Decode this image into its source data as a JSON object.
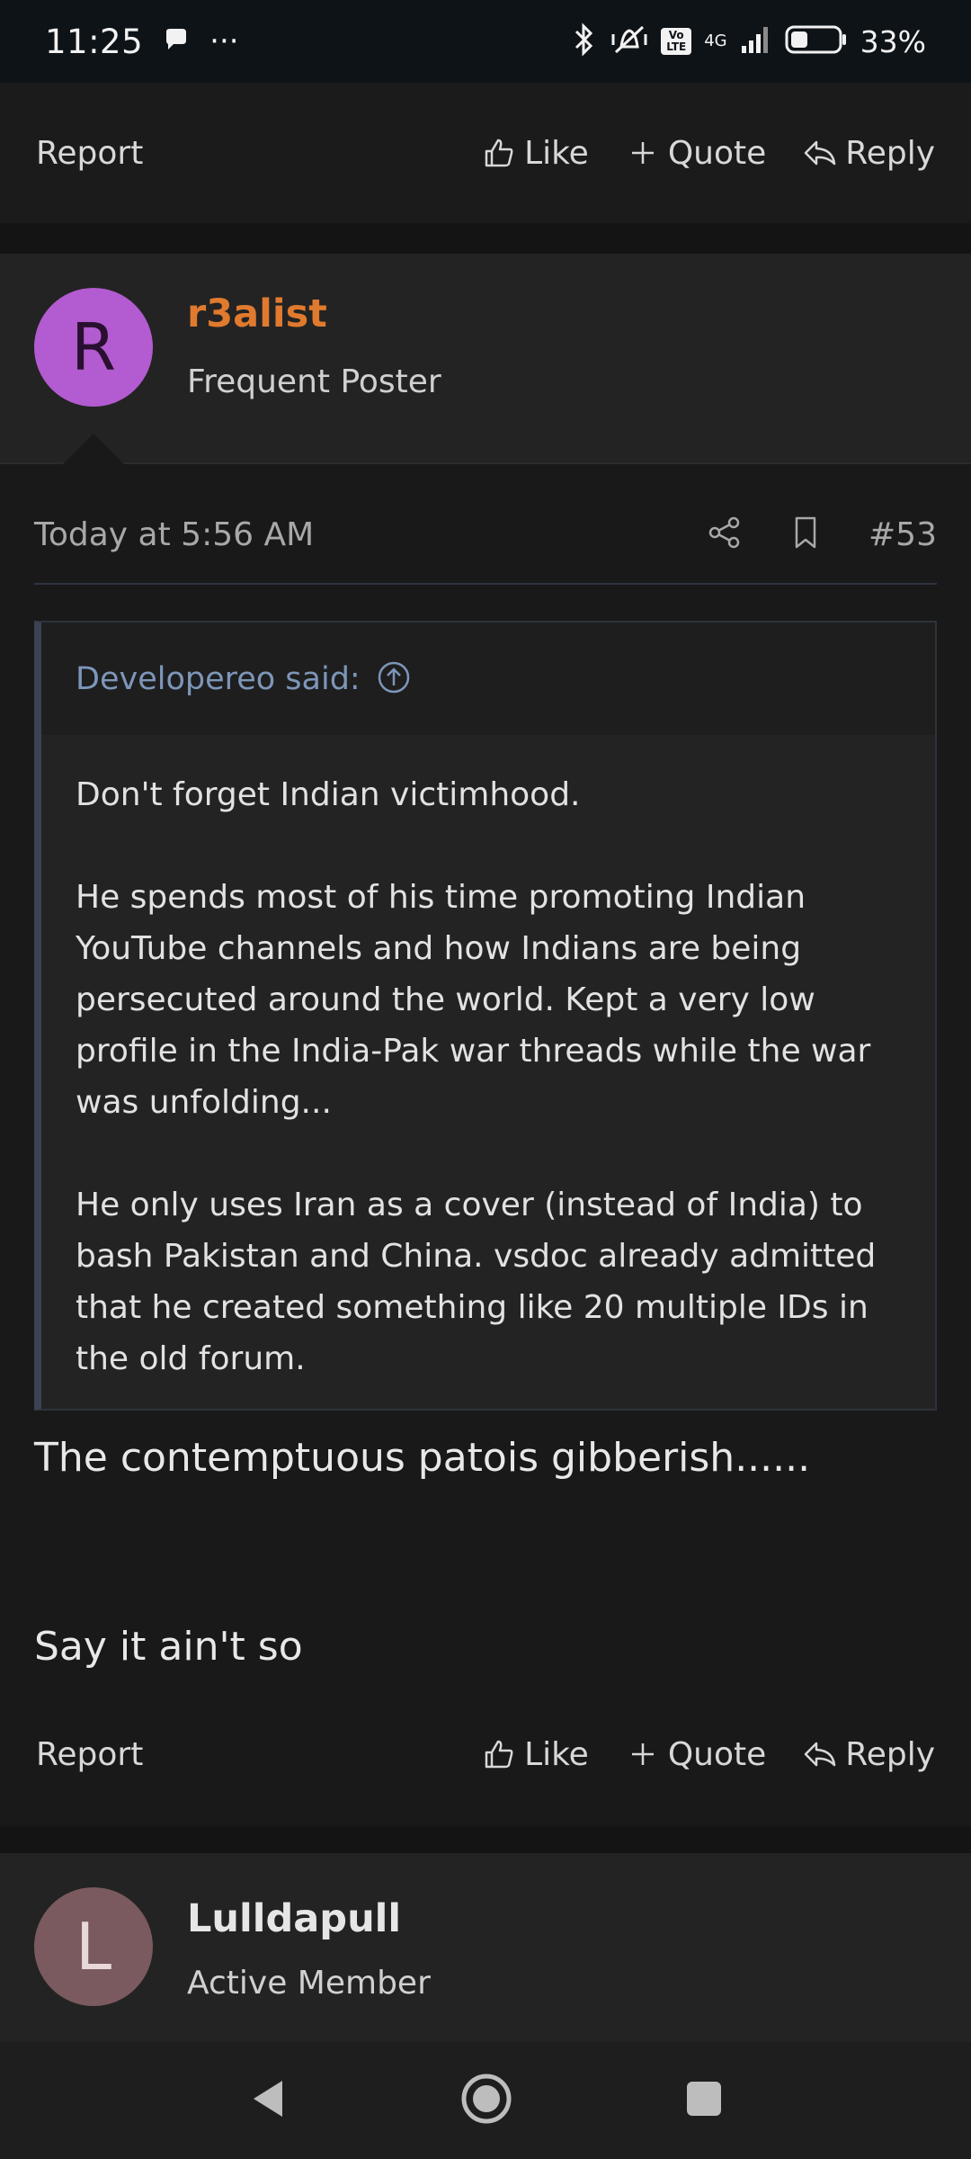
{
  "status_bar": {
    "time": "11:25",
    "more": "···",
    "network": "4G",
    "volte": "Vo LTE",
    "battery_pct": "33%"
  },
  "action_bar": {
    "report": "Report",
    "like": "Like",
    "quote": "Quote",
    "reply": "Reply"
  },
  "post": {
    "avatar_letter": "R",
    "avatar_color": "#b35bd0",
    "username": "r3alist",
    "username_color": "#e07a2e",
    "user_title": "Frequent Poster",
    "date": "Today at 5:56 AM",
    "post_number": "#53",
    "quote": {
      "author_line": "Developereo said:",
      "paragraphs": [
        "Don't forget Indian victimhood.",
        "He spends most of his time promoting Indian YouTube channels and how Indians are being persecuted around the world. Kept a very low profile in the India-Pak war threads while the war was unfolding...",
        "He only uses Iran as a cover (instead of India) to bash Pakistan and China. vsdoc already admitted that he created something like 20 multiple IDs in the old forum."
      ]
    },
    "body": [
      "The contemptuous patois gibberish......",
      "Say it ain't so"
    ]
  },
  "next_post": {
    "avatar_letter": "L",
    "avatar_color": "#7a5a5e",
    "username": "Lulldapull",
    "username_color": "#e6e6e6",
    "user_title": "Active Member"
  }
}
